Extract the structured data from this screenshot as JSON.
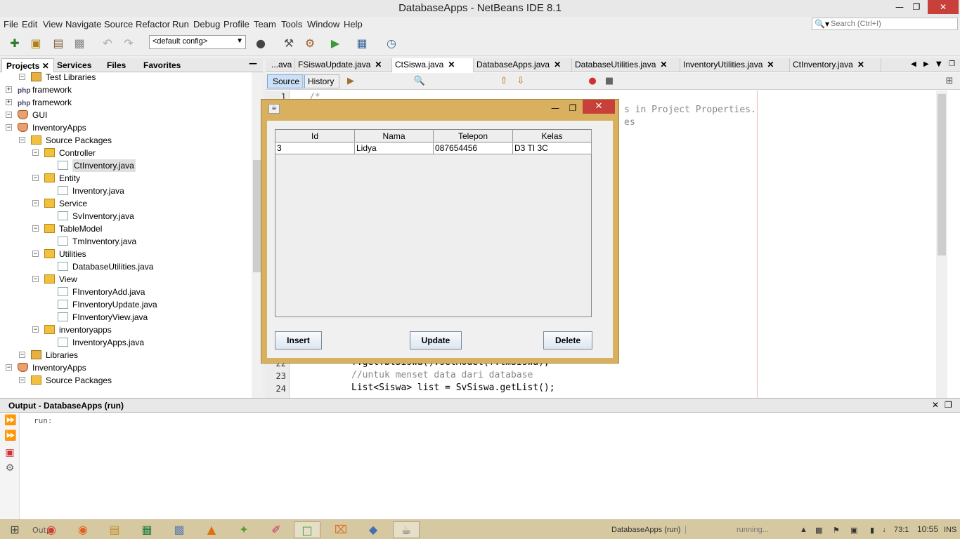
{
  "window": {
    "title": "DatabaseApps - NetBeans IDE 8.1"
  },
  "menu": [
    "File",
    "Edit",
    "View",
    "Navigate",
    "Source",
    "Refactor",
    "Run",
    "Debug",
    "Profile",
    "Team",
    "Tools",
    "Window",
    "Help"
  ],
  "search": {
    "placeholder": "Search (Ctrl+I)"
  },
  "toolbar": {
    "config": "<default config>"
  },
  "project_tabs": [
    "Projects",
    "Services",
    "Files",
    "Favorites"
  ],
  "tree": [
    {
      "label": "Test Libraries",
      "level": 1,
      "icon": "lib"
    },
    {
      "label": "framework",
      "level": 0,
      "icon": "php"
    },
    {
      "label": "framework",
      "level": 0,
      "icon": "php"
    },
    {
      "label": "GUI",
      "level": 0,
      "icon": "cup"
    },
    {
      "label": "InventoryApps",
      "level": 0,
      "icon": "cup"
    },
    {
      "label": "Source Packages",
      "level": 1,
      "icon": "pkg"
    },
    {
      "label": "Controller",
      "level": 2,
      "icon": "pkg"
    },
    {
      "label": "CtInventory.java",
      "level": 3,
      "icon": "java",
      "selected": true
    },
    {
      "label": "Entity",
      "level": 2,
      "icon": "pkg"
    },
    {
      "label": "Inventory.java",
      "level": 3,
      "icon": "java"
    },
    {
      "label": "Service",
      "level": 2,
      "icon": "pkg"
    },
    {
      "label": "SvInventory.java",
      "level": 3,
      "icon": "java"
    },
    {
      "label": "TableModel",
      "level": 2,
      "icon": "pkg"
    },
    {
      "label": "TmInventory.java",
      "level": 3,
      "icon": "java"
    },
    {
      "label": "Utilities",
      "level": 2,
      "icon": "pkg"
    },
    {
      "label": "DatabaseUtilities.java",
      "level": 3,
      "icon": "java"
    },
    {
      "label": "View",
      "level": 2,
      "icon": "pkg"
    },
    {
      "label": "FInventoryAdd.java",
      "level": 3,
      "icon": "java"
    },
    {
      "label": "FInventoryUpdate.java",
      "level": 3,
      "icon": "java"
    },
    {
      "label": "FInventoryView.java",
      "level": 3,
      "icon": "java"
    },
    {
      "label": "inventoryapps",
      "level": 2,
      "icon": "pkg"
    },
    {
      "label": "InventoryApps.java",
      "level": 3,
      "icon": "java"
    },
    {
      "label": "Libraries",
      "level": 1,
      "icon": "lib"
    },
    {
      "label": "InventoryApps",
      "level": 0,
      "icon": "cup"
    },
    {
      "label": "Source Packages",
      "level": 1,
      "icon": "pkg"
    }
  ],
  "editor_tabs": [
    "...ava",
    "FSiswaUpdate.java",
    "CtSiswa.java",
    "DatabaseApps.java",
    "DatabaseUtilities.java",
    "InventoryUtilities.java",
    "CtInventory.java"
  ],
  "editor": {
    "source_label": "Source",
    "history_label": "History",
    "lines": [
      {
        "no": "1",
        "text": "/*"
      },
      {
        "no": "",
        "text": "s in Project Properties."
      },
      {
        "no": "",
        "text": "es"
      },
      {
        "no": "22",
        "text": "f.getTblSiswa().setModel(f.tmSiswa);"
      },
      {
        "no": "23",
        "text": "//untuk menset data dari database"
      },
      {
        "no": "24",
        "text": "List<Siswa> list = SvSiswa.getList();"
      }
    ]
  },
  "output": {
    "title": "Output - DatabaseApps (run)",
    "text": "run:"
  },
  "dialog": {
    "columns": [
      "Id",
      "Nama",
      "Telepon",
      "Kelas"
    ],
    "rows": [
      [
        "3",
        "Lidya",
        "087654456",
        "D3 TI 3C"
      ]
    ],
    "buttons": {
      "insert": "Insert",
      "update": "Update",
      "delete": "Delete"
    }
  },
  "taskbar": {
    "status_app": "DatabaseApps (run)",
    "status_running": "running...",
    "position": "73:1",
    "time": "10:55",
    "mode": "INS",
    "output_label": "Outp"
  }
}
